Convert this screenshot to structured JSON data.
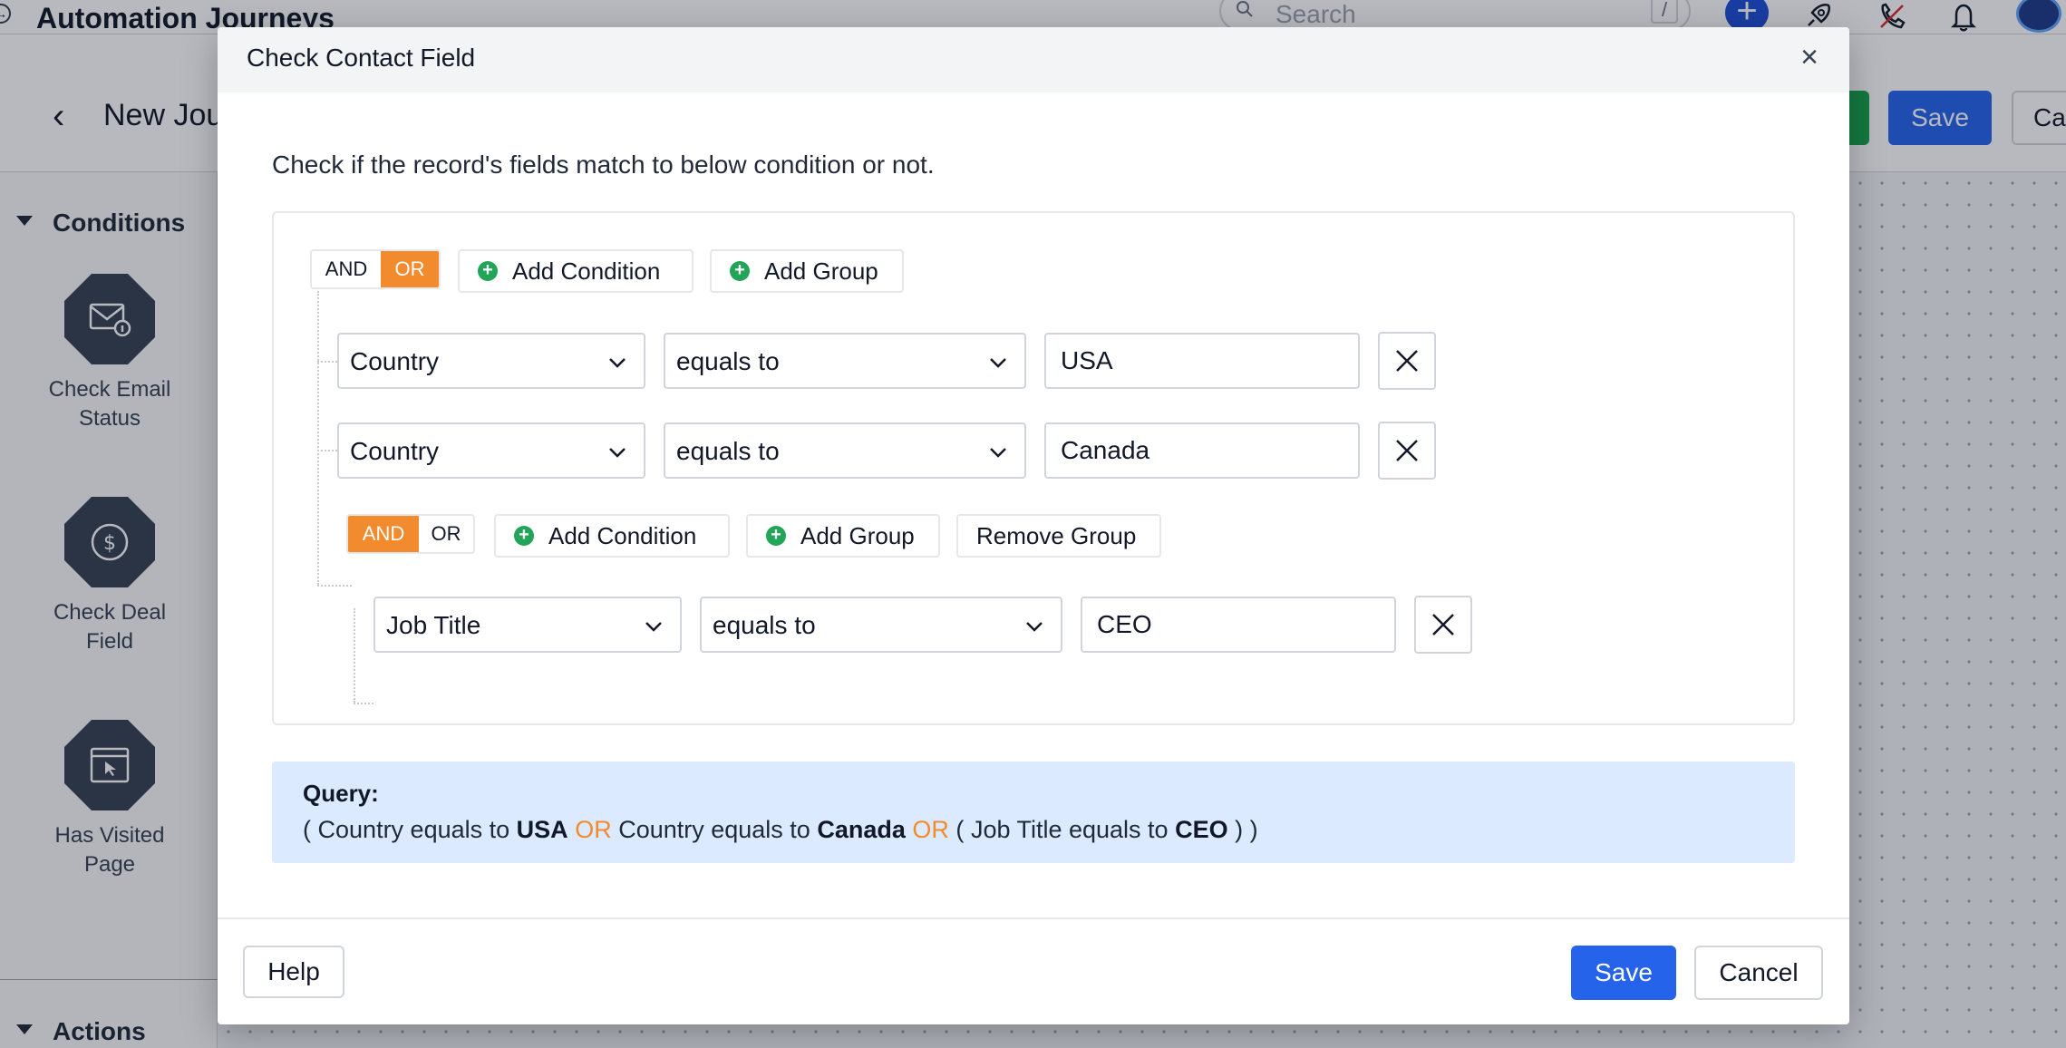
{
  "app": {
    "title": "Automation Journeys",
    "search_placeholder": "Search",
    "search_shortcut": "/",
    "journey_name": "New Jou",
    "header_save_label": "Save",
    "header_cancel_label": "Ca",
    "sidebar": {
      "conditions_title": "Conditions",
      "actions_title": "Actions",
      "nodes": [
        {
          "label": "Check Email Status",
          "icon": "envelope-info-icon"
        },
        {
          "label": "Check Deal Field",
          "icon": "dollar-coin-icon"
        },
        {
          "label": "Has Visited Page",
          "icon": "browser-cursor-icon"
        }
      ]
    }
  },
  "modal": {
    "title": "Check Contact Field",
    "description": "Check if the record's fields match to below condition or not.",
    "root_group": {
      "and_label": "AND",
      "or_label": "OR",
      "active_operator": "OR",
      "add_condition_label": "Add Condition",
      "add_group_label": "Add Group",
      "rules": [
        {
          "field": "Country",
          "operator": "equals to",
          "value": "USA"
        },
        {
          "field": "Country",
          "operator": "equals to",
          "value": "Canada"
        }
      ]
    },
    "nested_group": {
      "and_label": "AND",
      "or_label": "OR",
      "active_operator": "AND",
      "add_condition_label": "Add Condition",
      "add_group_label": "Add Group",
      "remove_group_label": "Remove Group",
      "rules": [
        {
          "field": "Job Title",
          "operator": "equals to",
          "value": "CEO"
        }
      ]
    },
    "query": {
      "label": "Query:",
      "open_paren": "(",
      "close_paren": ")",
      "part1_text": "Country equals to",
      "part1_value": "USA",
      "or1": "OR",
      "part2_text": "Country equals to",
      "part2_value": "Canada",
      "or2": "OR",
      "part3_text": "Job Title equals to",
      "part3_value": "CEO"
    },
    "help_label": "Help",
    "save_label": "Save",
    "cancel_label": "Cancel"
  },
  "colors": {
    "accent_orange": "#f28a2e",
    "primary_blue": "#2563eb",
    "add_green": "#22a559",
    "query_bg": "#dbeafe"
  }
}
